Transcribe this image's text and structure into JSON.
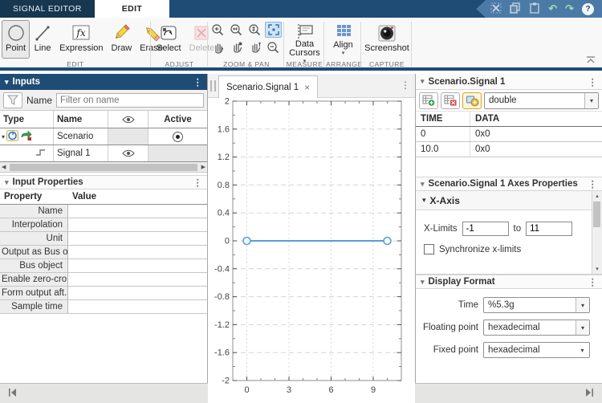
{
  "colors": {
    "accent": "#1e4c74",
    "quick_access": "#4b7aa6",
    "selection_highlight": "#cce4f6",
    "signal_line": "#54a0d8",
    "disabled_pink": "#f3c3c7"
  },
  "icons": {
    "caret_down": "▾",
    "caret_up": "▴",
    "menu_dots": "⋮",
    "close": "×",
    "scroll_left": "◀",
    "scroll_right": "▶",
    "undo": "↶",
    "redo": "↷",
    "help": "?"
  },
  "titlebar": {
    "tabs": [
      {
        "label": "SIGNAL EDITOR"
      },
      {
        "label": "EDIT",
        "active": true
      }
    ],
    "quick_access_icons": [
      "cut-icon",
      "copy-icon",
      "paste-icon",
      "undo-icon",
      "redo-icon",
      "help-icon"
    ]
  },
  "toolbar": {
    "groups": {
      "edit": "EDIT",
      "adjust": "ADJUST",
      "zoom_pan": "ZOOM & PAN",
      "measure": "MEASURE",
      "arrange": "ARRANGE",
      "capture": "CAPTURE"
    },
    "buttons": {
      "point": "Point",
      "line": "Line",
      "expression": "Expression",
      "expression_glyph": "fx",
      "draw": "Draw",
      "erase": "Erase",
      "select": "Select",
      "delete": "Delete",
      "data_cursors": "Data Cursors",
      "align": "Align",
      "screenshot": "Screenshot"
    }
  },
  "inputs": {
    "title": "Inputs",
    "filter_label": "Name",
    "filter_placeholder": "Filter on name",
    "columns": {
      "type": "Type",
      "name": "Name",
      "active": "Active"
    },
    "rows": [
      {
        "name": "Scenario",
        "active": true
      },
      {
        "name": "Signal 1",
        "visible": true
      }
    ]
  },
  "input_properties": {
    "title": "Input Properties",
    "columns": {
      "property": "Property",
      "value": "Value"
    },
    "rows": [
      "Name",
      "Interpolation",
      "Unit",
      "Output as Bus o...",
      "Bus object",
      "Enable zero-cro...",
      "Form output aft...",
      "Sample time"
    ]
  },
  "plot_tab": {
    "label": "Scenario.Signal 1"
  },
  "chart_data": {
    "type": "line",
    "title": "",
    "xlabel": "",
    "ylabel": "",
    "x": [
      0,
      10
    ],
    "y": [
      0,
      0
    ],
    "xlim": [
      -1,
      11
    ],
    "ylim": [
      -2,
      2
    ],
    "xticks": [
      0,
      3,
      6,
      9
    ],
    "yticks": [
      2,
      1.6,
      1.2,
      0.8,
      0.4,
      0,
      -0.4,
      -0.8,
      -1.2,
      -1.6,
      -2
    ],
    "x_minor_step": 1,
    "y_minor_step": 0.2,
    "grid": true,
    "line_color": "#54a0d8",
    "marker": "circle-open"
  },
  "signal_panel": {
    "title": "Scenario.Signal 1",
    "datatype": "double",
    "columns": {
      "time": "TIME",
      "data": "DATA"
    },
    "rows": [
      {
        "time": "0",
        "data": "0x0"
      },
      {
        "time": "10.0",
        "data": "0x0"
      }
    ]
  },
  "axes_panel": {
    "title": "Scenario.Signal 1 Axes Properties",
    "x_axis_section": "X-Axis",
    "x_limits_label": "X-Limits",
    "x_min": "-1",
    "to_label": "to",
    "x_max": "11",
    "sync_label": "Synchronize x-limits"
  },
  "display_format": {
    "title": "Display Format",
    "fields": [
      {
        "label": "Time",
        "value": "%5.3g"
      },
      {
        "label": "Floating point",
        "value": "hexadecimal"
      },
      {
        "label": "Fixed point",
        "value": "hexadecimal"
      }
    ]
  }
}
